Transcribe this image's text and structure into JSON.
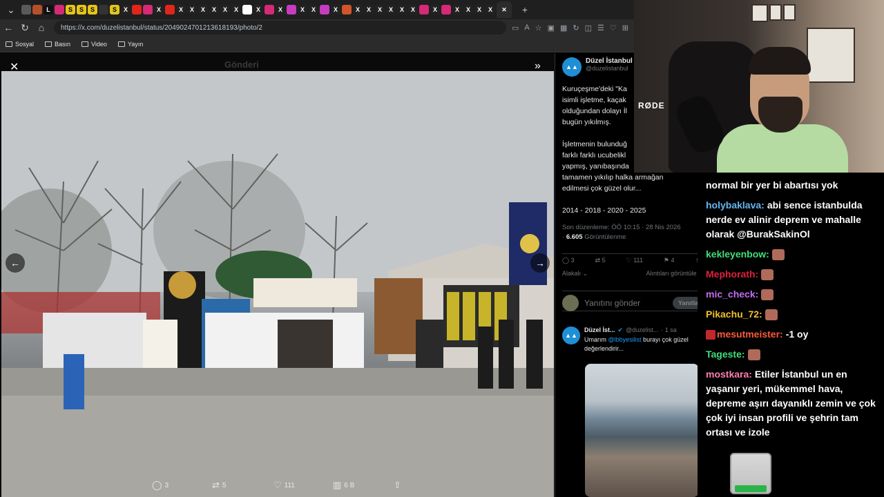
{
  "browser": {
    "url": "https://x.com/duzelistanbul/status/2049024701213618193/photo/2",
    "bookmarks": [
      "Sosyal",
      "Basın",
      "Video",
      "Yayın"
    ],
    "tabs": [
      {
        "glyph": "",
        "color": "#5a5a5a"
      },
      {
        "glyph": "",
        "color": "#b5502a"
      },
      {
        "glyph": "L",
        "color": "#111111"
      },
      {
        "glyph": "",
        "color": "#d62976"
      },
      {
        "glyph": "S",
        "color": "#e3c51b"
      },
      {
        "glyph": "S",
        "color": "#e3c51b"
      },
      {
        "glyph": "S",
        "color": "#e3c51b"
      },
      {
        "glyph": "",
        "color": "#333333"
      },
      {
        "glyph": "S",
        "color": "#e3c51b"
      },
      {
        "glyph": "X",
        "color": "#222222"
      },
      {
        "glyph": "",
        "color": "#e0261b"
      },
      {
        "glyph": "",
        "color": "#d62976"
      },
      {
        "glyph": "X",
        "color": "#222222"
      },
      {
        "glyph": "",
        "color": "#e0261b"
      },
      {
        "glyph": "X",
        "color": "#222222"
      },
      {
        "glyph": "X",
        "color": "#222222"
      },
      {
        "glyph": "X",
        "color": "#222222"
      },
      {
        "glyph": "X",
        "color": "#222222"
      },
      {
        "glyph": "X",
        "color": "#222222"
      },
      {
        "glyph": "X",
        "color": "#222222"
      },
      {
        "glyph": "",
        "color": "#ffffff"
      },
      {
        "glyph": "X",
        "color": "#222222"
      },
      {
        "glyph": "",
        "color": "#d62976"
      },
      {
        "glyph": "X",
        "color": "#222222"
      },
      {
        "glyph": "",
        "color": "#c73cbf"
      },
      {
        "glyph": "X",
        "color": "#222222"
      },
      {
        "glyph": "X",
        "color": "#222222"
      },
      {
        "glyph": "",
        "color": "#c73cbf"
      },
      {
        "glyph": "X",
        "color": "#222222"
      },
      {
        "glyph": "",
        "color": "#d1542a"
      },
      {
        "glyph": "X",
        "color": "#222222"
      },
      {
        "glyph": "X",
        "color": "#222222"
      },
      {
        "glyph": "X",
        "color": "#222222"
      },
      {
        "glyph": "X",
        "color": "#222222"
      },
      {
        "glyph": "X",
        "color": "#222222"
      },
      {
        "glyph": "X",
        "color": "#222222"
      },
      {
        "glyph": "",
        "color": "#d62976"
      },
      {
        "glyph": "X",
        "color": "#222222"
      },
      {
        "glyph": "",
        "color": "#d62976"
      },
      {
        "glyph": "X",
        "color": "#222222"
      },
      {
        "glyph": "X",
        "color": "#222222"
      },
      {
        "glyph": "X",
        "color": "#222222"
      },
      {
        "glyph": "X",
        "color": "#222222"
      }
    ]
  },
  "viewer": {
    "ghost_title": "Gönderi",
    "actions": {
      "replies": "3",
      "reposts": "5",
      "likes": "111",
      "views": "6 B"
    }
  },
  "tweet": {
    "name": "Düzel İstanbul",
    "handle": "@duzelistanbul",
    "body": "Kuruçeşme'deki \"Ka\nisimli işletme, kaçak\nolduğundan dolayı İl\nbugün yıkılmış.\n\nİşletmenin bulunduğ\nfarklı farklı ucubelikl\nyapmış, yanıbaşında\ntamamen yıkılıp halka armağan\nedilmesi çok güzel olur...\n\n2014 - 2018 - 2020 - 2025",
    "edited": "Son düzenleme: ÖÖ 10:15 · 28 Nis 2026",
    "views_count": "6.605",
    "views_label": "Görüntülenme",
    "stats": {
      "replies": "3",
      "reposts": "5",
      "likes": "111",
      "bookmarks": "4"
    },
    "sort_label": "Alakalı",
    "quotes_label": "Alıntıları görüntüle",
    "reply_placeholder": "Yanıtını gönder",
    "reply_button": "Yanıtla"
  },
  "reply": {
    "name": "Düzel İst...",
    "handle": "@duzelist...",
    "time": "· 1 sa",
    "prefix": "Umarım",
    "mention": "@lbbyesilist",
    "text": " burayı çok güzel değerlendirir..."
  },
  "chat": [
    {
      "user": "",
      "color": "#ffffff",
      "text": "normal bir yer bi abartısı yok",
      "emote": false,
      "badge": false
    },
    {
      "user": "holybaklava:",
      "color": "#66b7f0",
      "text": "abi sence istanbulda nerde ev alinir deprem ve mahalle olarak @BurakSakinOl",
      "emote": false,
      "badge": false
    },
    {
      "user": "kekleyenbow:",
      "color": "#3fe07a",
      "text": "",
      "emote": true,
      "badge": false
    },
    {
      "user": "Mephorath:",
      "color": "#e0213b",
      "text": "",
      "emote": true,
      "badge": false
    },
    {
      "user": "mic_check:",
      "color": "#c36bf2",
      "text": "",
      "emote": true,
      "badge": false
    },
    {
      "user": "Pikachu_72:",
      "color": "#f2c12e",
      "text": "",
      "emote": true,
      "badge": false
    },
    {
      "user": "mesutmeister:",
      "color": "#ff5a3a",
      "text": "-1 oy",
      "emote": false,
      "badge": true
    },
    {
      "user": "Tageste:",
      "color": "#3fe07a",
      "text": "",
      "emote": true,
      "badge": false
    },
    {
      "user": "mostkara:",
      "color": "#ff7fb0",
      "text": "Etiler İstanbul un en yaşanır yeri, mükemmel hava, depreme aşırı dayanıklı zemin ve çok çok iyi insan profili ve şehrin tam ortası ve izole",
      "emote": false,
      "badge": false
    }
  ]
}
